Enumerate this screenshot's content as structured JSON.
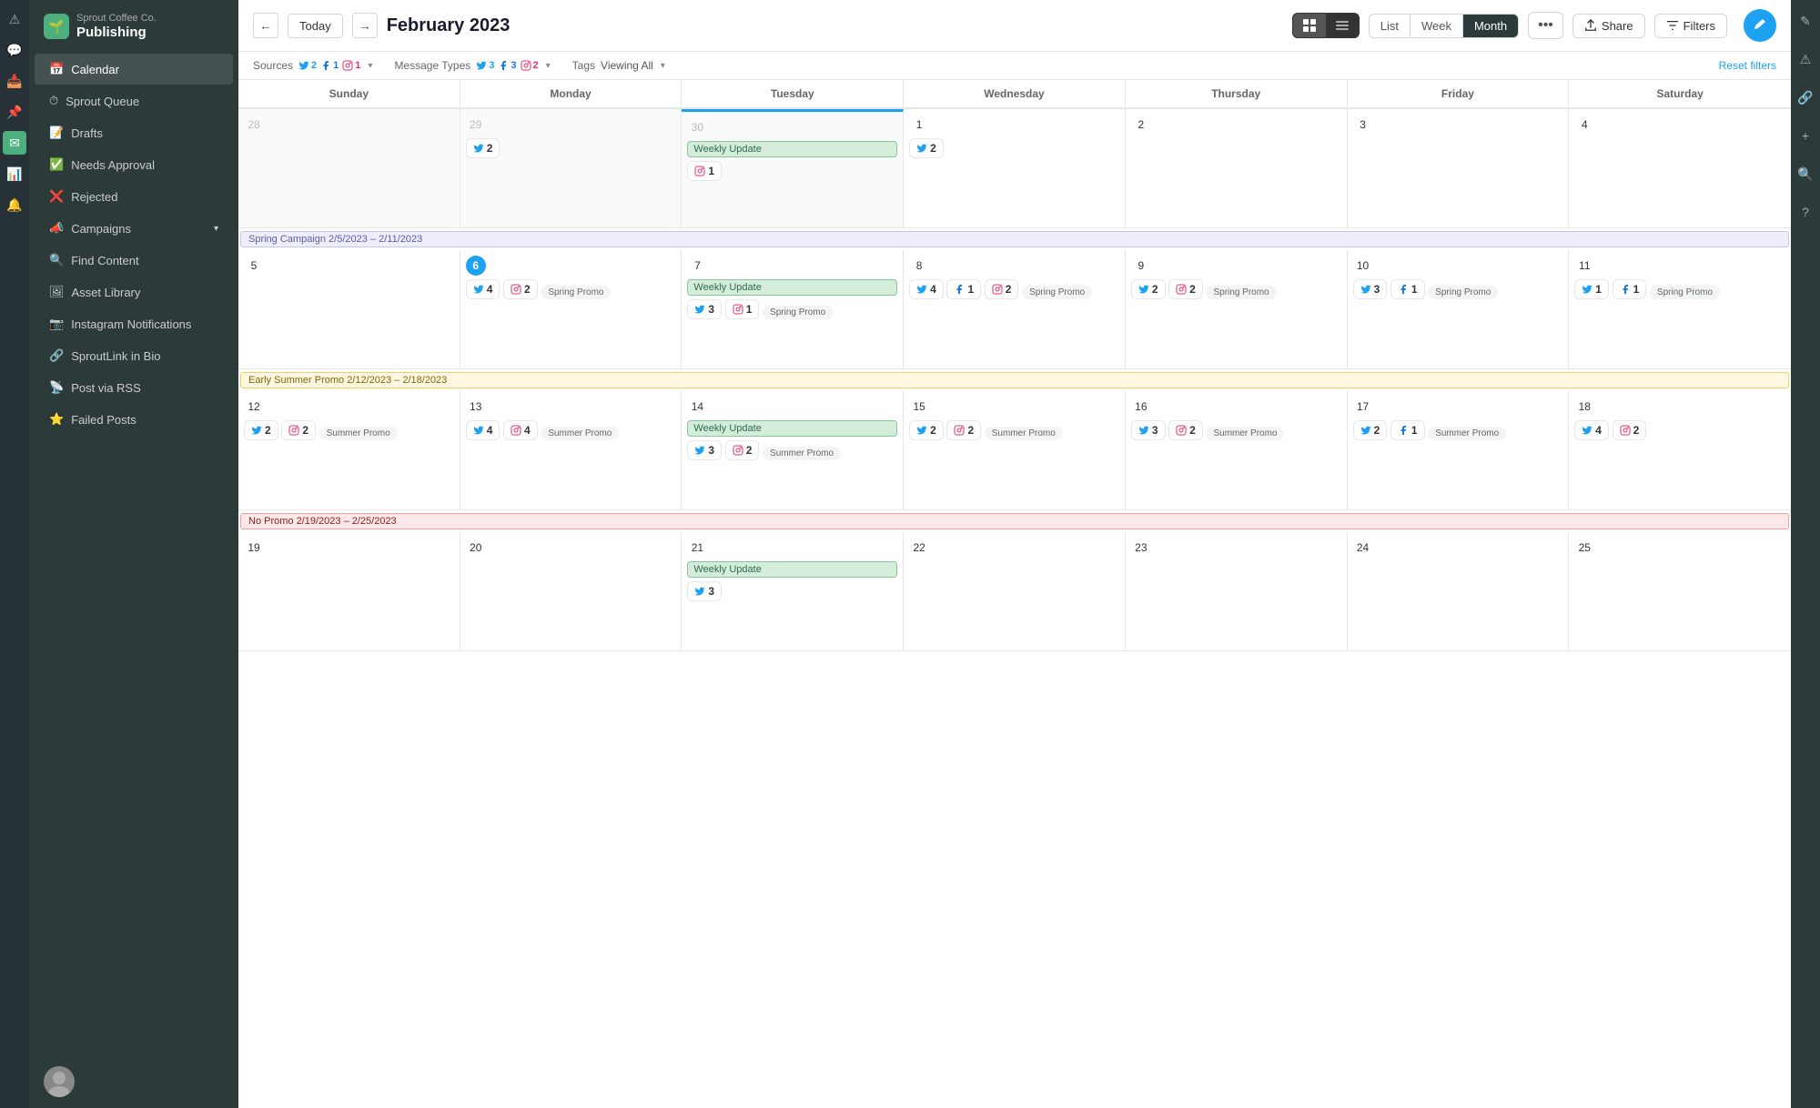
{
  "brand": {
    "company": "Sprout Coffee Co.",
    "app": "Publishing"
  },
  "sidebar": {
    "items": [
      {
        "id": "calendar",
        "label": "Calendar",
        "active": true
      },
      {
        "id": "sprout-queue",
        "label": "Sprout Queue"
      },
      {
        "id": "drafts",
        "label": "Drafts"
      },
      {
        "id": "needs-approval",
        "label": "Needs Approval"
      },
      {
        "id": "rejected",
        "label": "Rejected"
      },
      {
        "id": "campaigns",
        "label": "Campaigns",
        "hasArrow": true
      },
      {
        "id": "find-content",
        "label": "Find Content"
      },
      {
        "id": "asset-library",
        "label": "Asset Library"
      },
      {
        "id": "instagram-notifications",
        "label": "Instagram Notifications"
      },
      {
        "id": "sproutlink-in-bio",
        "label": "SproutLink in Bio"
      },
      {
        "id": "post-via-rss",
        "label": "Post via RSS"
      },
      {
        "id": "failed-posts",
        "label": "Failed Posts"
      }
    ]
  },
  "topbar": {
    "prev_label": "←",
    "today_label": "Today",
    "next_label": "→",
    "month_title": "February 2023",
    "view_grid": "⊞",
    "view_list_icon": "≡",
    "nav_list": "List",
    "nav_week": "Week",
    "nav_month": "Month",
    "more": "•••",
    "share": "Share",
    "filters": "Filters",
    "compose": "✎"
  },
  "filters": {
    "sources_label": "Sources",
    "tw_count": "2",
    "fb_count": "1",
    "ig_count": "1",
    "message_types_label": "Message Types",
    "mt_tw": "3",
    "mt_fb": "3",
    "mt_ig": "2",
    "tags_label": "Tags",
    "tags_value": "Viewing All",
    "reset": "Reset filters"
  },
  "days_headers": [
    "Sunday",
    "Monday",
    "Tuesday",
    "Wednesday",
    "Thursday",
    "Friday",
    "Saturday"
  ],
  "weeks": [
    {
      "id": "week1",
      "campaign": null,
      "days": [
        {
          "num": "28",
          "other": true,
          "chips": []
        },
        {
          "num": "29",
          "other": true,
          "chips": [
            {
              "type": "tw",
              "count": "2"
            }
          ]
        },
        {
          "num": "30",
          "other": true,
          "event": "Weekly Update",
          "chips": [
            {
              "type": "ig",
              "count": "1"
            }
          ]
        },
        {
          "num": "1",
          "today": false,
          "chips": [
            {
              "type": "tw",
              "count": "2"
            }
          ]
        },
        {
          "num": "2",
          "chips": []
        },
        {
          "num": "3",
          "chips": []
        },
        {
          "num": "4",
          "chips": []
        }
      ]
    },
    {
      "id": "week2",
      "campaign": {
        "label": "Spring Campaign 2/5/2023 – 2/11/2023",
        "type": "spring",
        "startCol": 0,
        "span": 7
      },
      "days": [
        {
          "num": "5",
          "chips": []
        },
        {
          "num": "6",
          "today": true,
          "chips": [
            {
              "type": "tw",
              "count": "4"
            },
            {
              "type": "ig",
              "count": "2"
            }
          ],
          "promo": "Spring Promo"
        },
        {
          "num": "7",
          "event": "Weekly Update",
          "chips": [
            {
              "type": "tw",
              "count": "3"
            },
            {
              "type": "ig",
              "count": "1"
            }
          ],
          "promo": "Spring Promo"
        },
        {
          "num": "8",
          "chips": [
            {
              "type": "tw",
              "count": "4"
            },
            {
              "type": "fb",
              "count": "1"
            },
            {
              "type": "ig",
              "count": "2"
            }
          ],
          "promo": "Spring Promo"
        },
        {
          "num": "9",
          "chips": [
            {
              "type": "tw",
              "count": "2"
            },
            {
              "type": "ig",
              "count": "2"
            }
          ],
          "promo": "Spring Promo"
        },
        {
          "num": "10",
          "chips": [
            {
              "type": "tw",
              "count": "3"
            },
            {
              "type": "fb",
              "count": "1"
            }
          ],
          "promo": "Spring Promo"
        },
        {
          "num": "11",
          "chips": [
            {
              "type": "tw",
              "count": "1"
            },
            {
              "type": "fb",
              "count": "1"
            }
          ],
          "promo": "Spring Promo"
        }
      ]
    },
    {
      "id": "week3",
      "campaign": {
        "label": "Early Summer Promo 2/12/2023 – 2/18/2023",
        "type": "summer",
        "startCol": 0,
        "span": 7
      },
      "days": [
        {
          "num": "12",
          "chips": [
            {
              "type": "tw",
              "count": "2"
            },
            {
              "type": "ig",
              "count": "2"
            }
          ],
          "promo": "Summer Promo"
        },
        {
          "num": "13",
          "chips": [
            {
              "type": "tw",
              "count": "4"
            },
            {
              "type": "ig",
              "count": "4"
            }
          ],
          "promo": "Summer Promo"
        },
        {
          "num": "14",
          "event": "Weekly Update",
          "chips": [
            {
              "type": "tw",
              "count": "3"
            },
            {
              "type": "ig",
              "count": "2"
            }
          ],
          "promo": "Summer Promo"
        },
        {
          "num": "15",
          "chips": [
            {
              "type": "tw",
              "count": "2"
            },
            {
              "type": "ig",
              "count": "2"
            }
          ],
          "promo": "Summer Promo"
        },
        {
          "num": "16",
          "chips": [
            {
              "type": "tw",
              "count": "3"
            },
            {
              "type": "ig",
              "count": "2"
            }
          ],
          "promo": "Summer Promo"
        },
        {
          "num": "17",
          "chips": [
            {
              "type": "tw",
              "count": "2"
            },
            {
              "type": "fb",
              "count": "1"
            }
          ],
          "promo": "Summer Promo"
        },
        {
          "num": "18",
          "chips": [
            {
              "type": "tw",
              "count": "4"
            },
            {
              "type": "ig",
              "count": "2"
            }
          ],
          "promo": ""
        }
      ]
    },
    {
      "id": "week4",
      "campaign": {
        "label": "No Promo 2/19/2023 – 2/25/2023",
        "type": "nopromo",
        "startCol": 0,
        "span": 7
      },
      "days": [
        {
          "num": "19",
          "chips": []
        },
        {
          "num": "20",
          "chips": []
        },
        {
          "num": "21",
          "event": "Weekly Update",
          "chips": [
            {
              "type": "tw",
              "count": "3"
            }
          ]
        },
        {
          "num": "22",
          "chips": []
        },
        {
          "num": "23",
          "chips": []
        },
        {
          "num": "24",
          "chips": []
        },
        {
          "num": "25",
          "chips": []
        }
      ]
    }
  ],
  "colors": {
    "twitter_blue": "#1da1f2",
    "facebook_blue": "#1877f2",
    "instagram_pink": "#e1306c",
    "spring_bg": "#eeeef8",
    "spring_border": "#c5c5e8",
    "spring_text": "#5c5ca8",
    "summer_bg": "#fff8e1",
    "summer_border": "#f0d060",
    "summer_text": "#7d6608",
    "nopromo_bg": "#fce8e8",
    "nopromo_border": "#f0a0a0",
    "nopromo_text": "#8b2020"
  }
}
